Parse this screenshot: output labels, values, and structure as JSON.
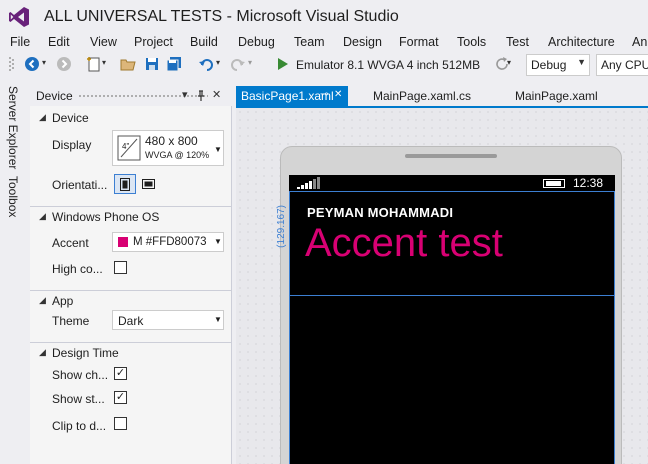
{
  "window": {
    "title": "ALL UNIVERSAL TESTS - Microsoft Visual Studio"
  },
  "menu": [
    "File",
    "Edit",
    "View",
    "Project",
    "Build",
    "Debug",
    "Team",
    "Design",
    "Format",
    "Tools",
    "Test",
    "Architecture",
    "An"
  ],
  "toolbar": {
    "run_target": "Emulator 8.1 WVGA 4 inch 512MB",
    "configuration": "Debug",
    "platform": "Any CPU"
  },
  "side_tabs": [
    "Server Explorer",
    "Toolbox"
  ],
  "device_panel": {
    "title": "Device",
    "sections": {
      "device": {
        "title": "Device",
        "display_label": "Display",
        "display_size": "4\"",
        "display_resolution": "480 x 800",
        "display_sub": "WVGA @ 120%",
        "orientation_label": "Orientati..."
      },
      "os": {
        "title": "Windows Phone OS",
        "accent_label": "Accent",
        "accent_value": "M #FFD80073",
        "accent_color": "#D80073",
        "high_contrast_label": "High co..."
      },
      "app": {
        "title": "App",
        "theme_label": "Theme",
        "theme_value": "Dark"
      },
      "design_time": {
        "title": "Design Time",
        "show_chrome_label": "Show ch...",
        "show_status_label": "Show st...",
        "clip_label": "Clip to d..."
      }
    }
  },
  "editor_tabs": [
    {
      "label": "BasicPage1.xaml",
      "active": true
    },
    {
      "label": "MainPage.xaml.cs",
      "active": false
    },
    {
      "label": "MainPage.xaml",
      "active": false
    }
  ],
  "phone": {
    "status_time": "12:38",
    "app_title": "PEYMAN MOHAMMADI",
    "page_title": "Accent test",
    "accent_color": "#D80073",
    "margin_label": "(129.167)"
  }
}
